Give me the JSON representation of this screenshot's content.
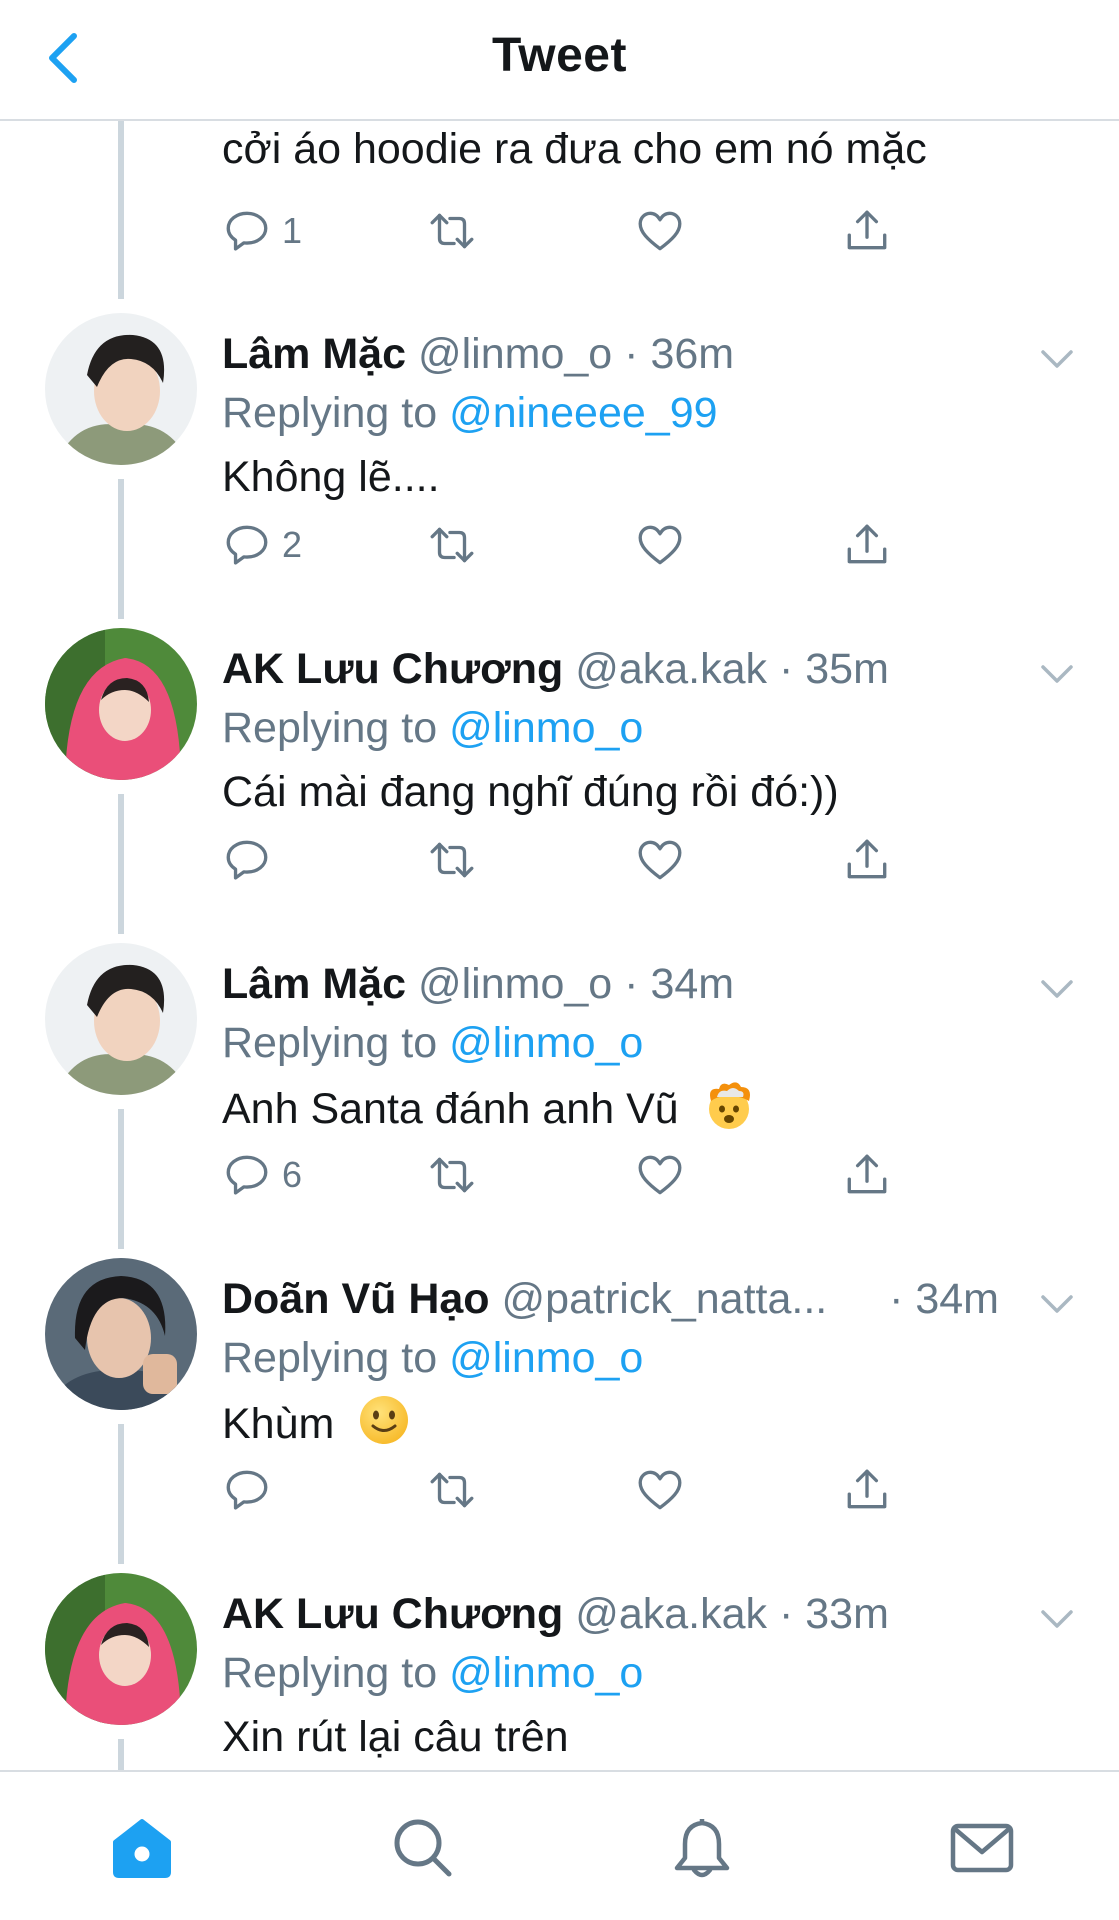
{
  "header": {
    "title": "Tweet"
  },
  "first_tweet": {
    "text": "cởi áo hoodie ra đưa cho em nó mặc",
    "reply_count": "1"
  },
  "replying_label": "Replying to",
  "tweets": [
    {
      "name": "Lâm Mặc",
      "handle": "@linmo_o",
      "time": "36m",
      "reply_to": "@nineeee_99",
      "text": "Không lẽ....",
      "reply_count": "2"
    },
    {
      "name": "AK Lưu Chương",
      "handle": "@aka.kak",
      "time": "35m",
      "reply_to": "@linmo_o",
      "text": "Cái mài đang nghĩ đúng rồi đó:))",
      "reply_count": ""
    },
    {
      "name": "Lâm Mặc",
      "handle": "@linmo_o",
      "time": "34m",
      "reply_to": "@linmo_o",
      "text": "Anh Santa đánh anh Vũ",
      "emoji": "exploding-head-emoji",
      "reply_count": "6"
    },
    {
      "name": "Doãn Vũ Hạo",
      "handle": "@patrick_natta...",
      "time": "34m",
      "reply_to": "@linmo_o",
      "text": "Khùm",
      "emoji": "slightly-smiling-face-emoji",
      "reply_count": ""
    },
    {
      "name": "AK Lưu Chương",
      "handle": "@aka.kak",
      "time": "33m",
      "reply_to": "@linmo_o",
      "text": "Xin rút lại câu trên",
      "reply_count": ""
    }
  ],
  "colors": {
    "link": "#1da1f2",
    "muted": "#657786",
    "thread_line": "#ccd6dd",
    "text": "#14171a"
  },
  "tabbar": {
    "items": [
      "home-icon",
      "search-icon",
      "notifications-icon",
      "messages-icon"
    ],
    "active": "home-icon"
  }
}
